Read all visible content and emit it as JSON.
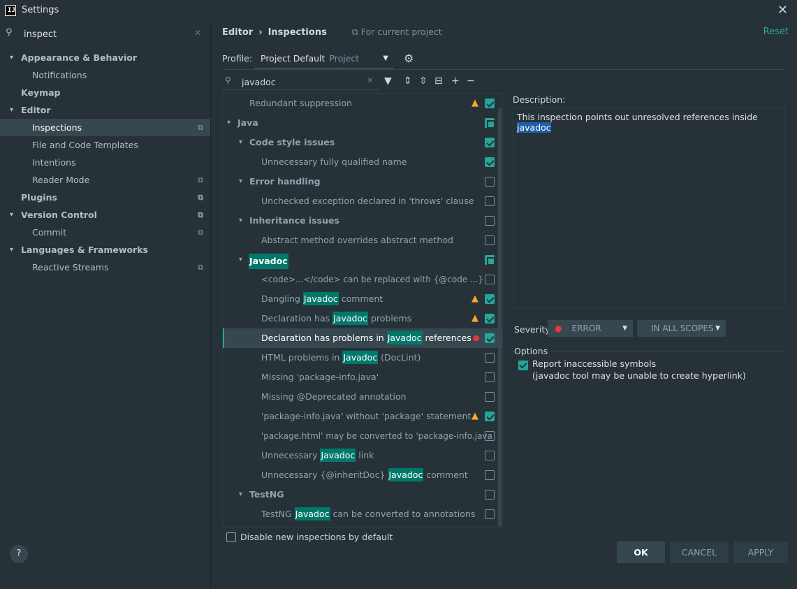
{
  "window": {
    "title": "Settings",
    "logo_text": "IJ",
    "close_icon": "✕"
  },
  "sidebar": {
    "search_value": "inspect",
    "items": [
      {
        "label": "Appearance & Behavior",
        "chevron": "▾"
      },
      {
        "label": "Notifications"
      },
      {
        "label": "Keymap"
      },
      {
        "label": "Editor",
        "chevron": "▾"
      },
      {
        "label": "Inspections"
      },
      {
        "label": "File and Code Templates"
      },
      {
        "label": "Intentions"
      },
      {
        "label": "Reader Mode"
      },
      {
        "label": "Plugins"
      },
      {
        "label": "Version Control",
        "chevron": "▾"
      },
      {
        "label": "Commit"
      },
      {
        "label": "Languages & Frameworks",
        "chevron": "▾"
      },
      {
        "label": "Reactive Streams"
      }
    ]
  },
  "header": {
    "crumb1": "Editor",
    "sep": "›",
    "crumb2": "Inspections",
    "project_icon": "⧉",
    "project_note": "For current project",
    "reset": "Reset"
  },
  "profile": {
    "label": "Profile:",
    "value": "Project Default",
    "sub": "Project"
  },
  "filter": {
    "value": "javadoc"
  },
  "tree": {
    "rows": [
      {
        "text": "Redundant suppression"
      },
      {
        "text": "Java"
      },
      {
        "text": "Code style issues"
      },
      {
        "text": "Unnecessary fully qualified name"
      },
      {
        "text": "Error handling"
      },
      {
        "text": "Unchecked exception declared in 'throws' clause"
      },
      {
        "text": "Inheritance issues"
      },
      {
        "text": "Abstract method overrides abstract method"
      },
      {
        "text": "Javadoc"
      },
      {
        "text": "<code>...</code> can be replaced with {@code ...}"
      },
      {
        "pre": "Dangling ",
        "hl": "Javadoc",
        "post": " comment"
      },
      {
        "pre": "Declaration has ",
        "hl": "Javadoc",
        "post": " problems"
      },
      {
        "pre": "Declaration has problems in ",
        "hl": "Javadoc",
        "post": " references"
      },
      {
        "pre": "HTML problems in ",
        "hl": "Javadoc",
        "post": " (DocLint)"
      },
      {
        "text": "Missing 'package-info.java'"
      },
      {
        "text": "Missing @Deprecated annotation"
      },
      {
        "text": "'package-info.java' without 'package' statement"
      },
      {
        "text": "'package.html' may be converted to 'package-info.java"
      },
      {
        "pre": "Unnecessary ",
        "hl": "Javadoc",
        "post": " link"
      },
      {
        "pre": "Unnecessary {@inheritDoc} ",
        "hl": "Javadoc",
        "post": " comment"
      },
      {
        "text": "TestNG"
      },
      {
        "pre": "TestNG ",
        "hl": "Javadoc",
        "post": " can be converted to annotations"
      }
    ]
  },
  "disable_new": "Disable new inspections by default",
  "description": {
    "label": "Description:",
    "text": "This inspection points out unresolved references inside ",
    "highlight": "javadoc"
  },
  "severity": {
    "label": "Severity:",
    "value": "ERROR",
    "scope": "IN ALL SCOPES"
  },
  "options": {
    "label": "Options",
    "line1": "Report inaccessible symbols",
    "line2": "(javadoc tool may be unable to create hyperlink)"
  },
  "footer": {
    "help": "?",
    "ok": "OK",
    "cancel": "CANCEL",
    "apply": "APPLY"
  },
  "colors": {
    "accent": "#26a69a",
    "background": "#263238",
    "selection": "#37474f",
    "warning": "#f9a825",
    "error": "#e53935"
  }
}
